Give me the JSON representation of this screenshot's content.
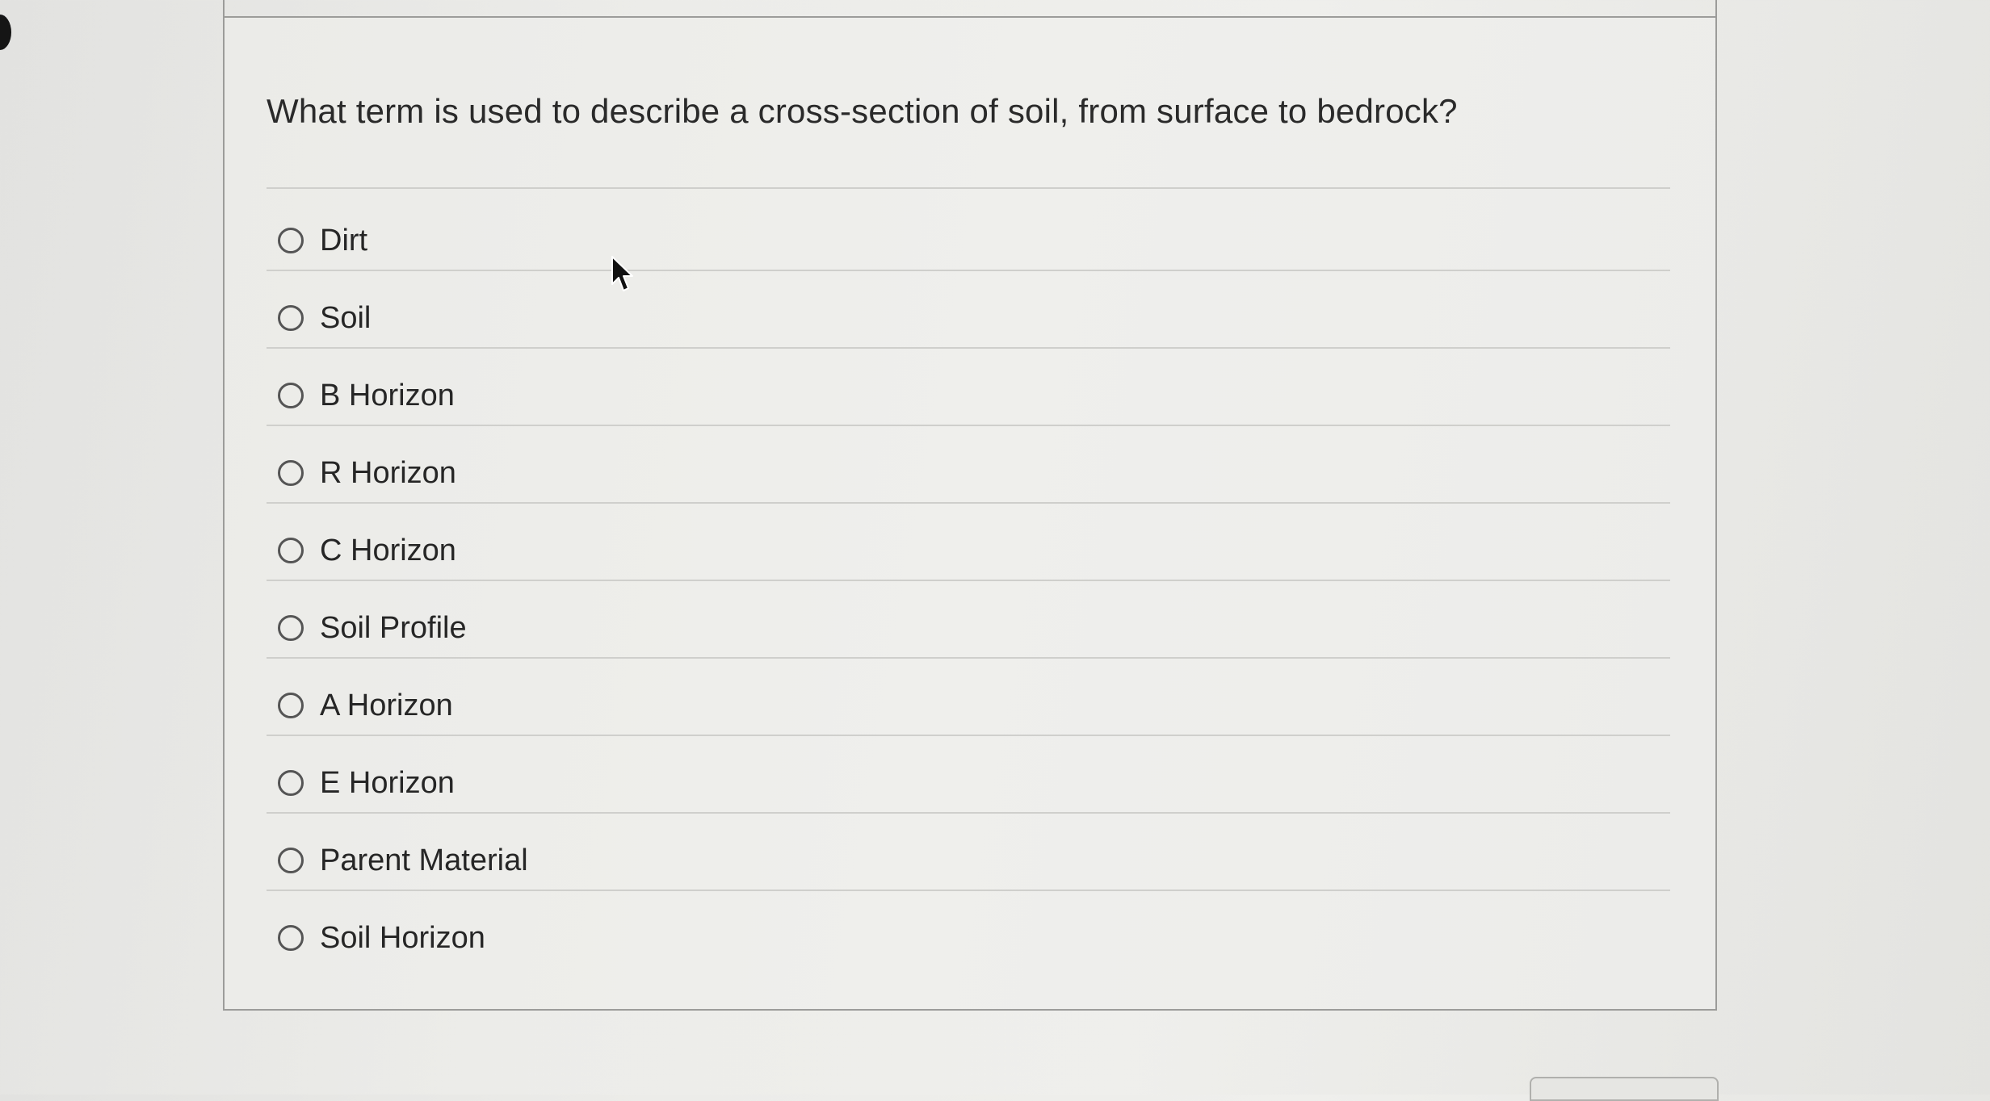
{
  "question": {
    "text": "What term is used to describe a cross-section of soil, from surface to bedrock?"
  },
  "options": [
    {
      "label": "Dirt",
      "selected": false
    },
    {
      "label": "Soil",
      "selected": false
    },
    {
      "label": "B Horizon",
      "selected": false
    },
    {
      "label": "R Horizon",
      "selected": false
    },
    {
      "label": "C Horizon",
      "selected": false
    },
    {
      "label": "Soil Profile",
      "selected": false
    },
    {
      "label": "A Horizon",
      "selected": false
    },
    {
      "label": "E Horizon",
      "selected": false
    },
    {
      "label": "Parent Material",
      "selected": false
    },
    {
      "label": "Soil Horizon",
      "selected": false
    }
  ],
  "icons": {
    "cursor": "mouse-pointer-icon",
    "radio": "radio-unselected-icon"
  }
}
